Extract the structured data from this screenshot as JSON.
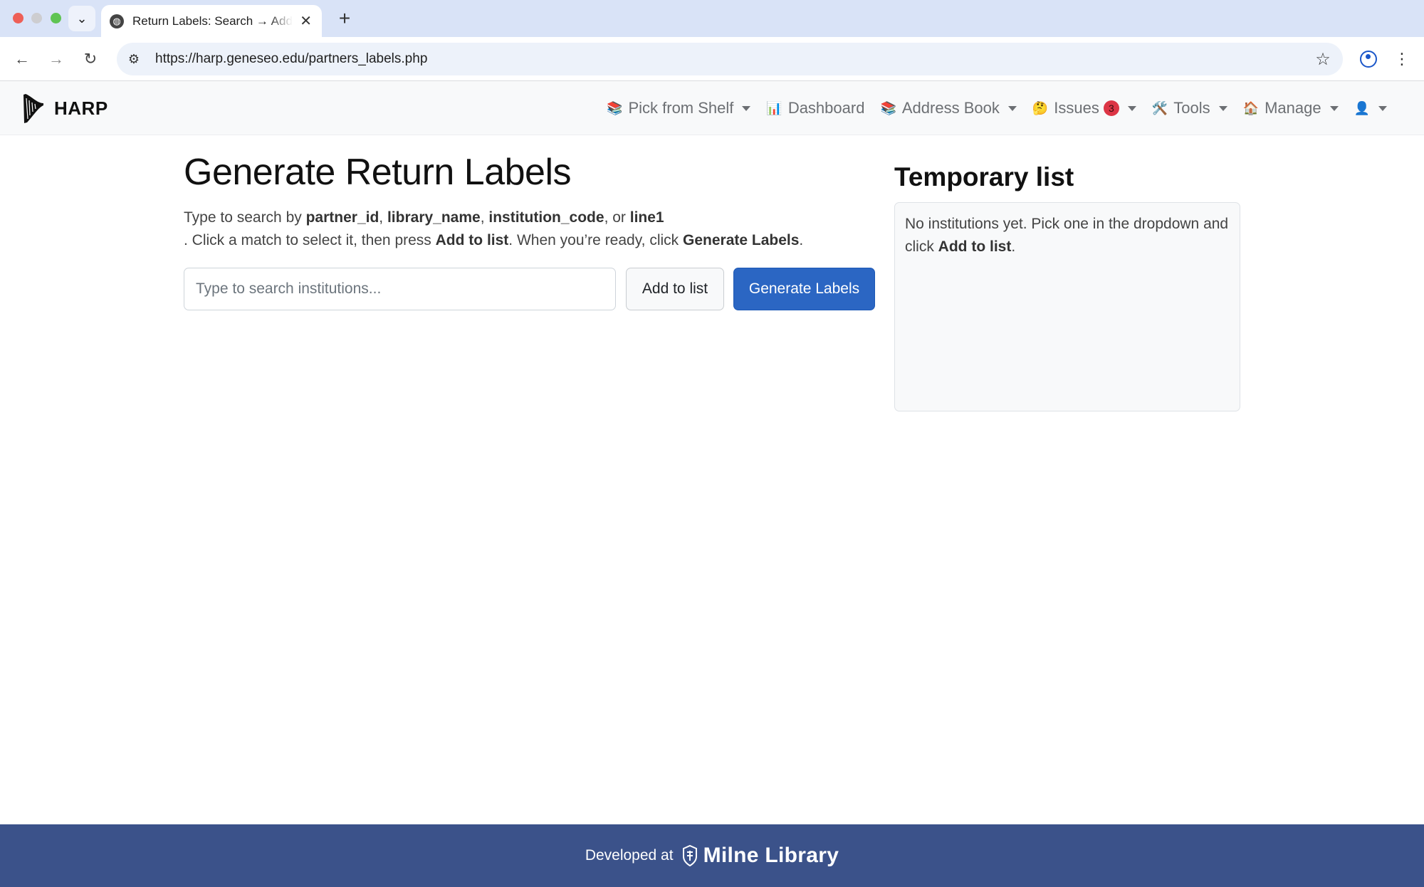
{
  "browser": {
    "tab_title": "Return Labels: Search → Add",
    "url": "https://harp.geneseo.edu/partners_labels.php"
  },
  "navbar": {
    "brand": "HARP",
    "items": [
      {
        "label": "Pick from Shelf",
        "icon": "📚"
      },
      {
        "label": "Dashboard",
        "icon": "📊"
      },
      {
        "label": "Address Book",
        "icon": "📚"
      },
      {
        "label": "Issues",
        "icon": "🤔",
        "badge": "3"
      },
      {
        "label": "Tools",
        "icon": "🛠️"
      },
      {
        "label": "Manage",
        "icon": "🏠"
      },
      {
        "label": "",
        "icon": "👤"
      }
    ]
  },
  "main": {
    "title": "Generate Return Labels",
    "intro_prefix": "Type to search by ",
    "field1": "partner_id",
    "sep1": ", ",
    "field2": "library_name",
    "sep2": ", ",
    "field3": "institution_code",
    "sep3": ", or ",
    "field4": "line1",
    "intro_mid": ". Click a match to select it, then press ",
    "add_ref": "Add to list",
    "intro_mid2": ". When you’re ready, click ",
    "gen_ref": "Generate Labels",
    "intro_end": ".",
    "search_placeholder": "Type to search institutions...",
    "add_button": "Add to list",
    "generate_button": "Generate Labels"
  },
  "sidebar": {
    "title": "Temporary list",
    "empty_prefix": "No institutions yet. Pick one in the dropdown and click ",
    "empty_bold": "Add to list",
    "empty_suffix": "."
  },
  "footer": {
    "developed_at": "Developed at",
    "library": "Milne Library"
  }
}
